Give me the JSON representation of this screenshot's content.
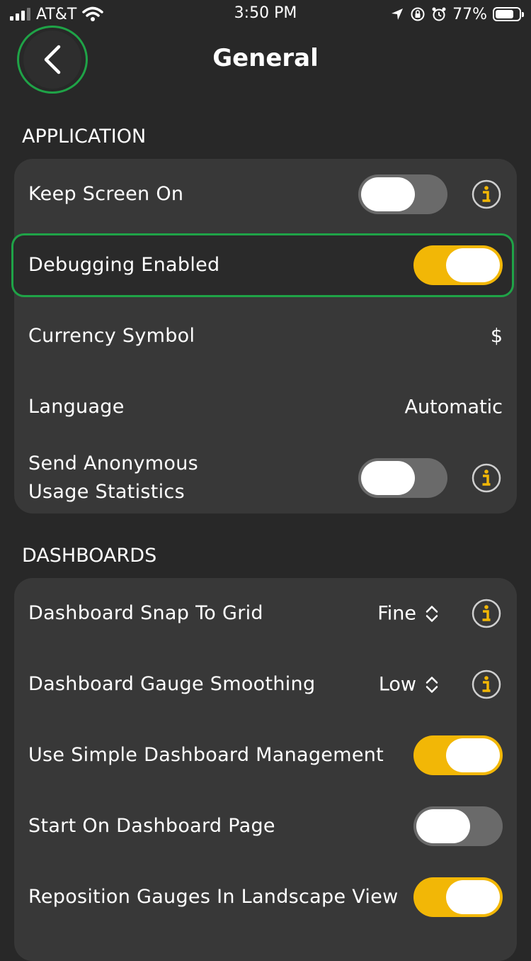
{
  "status_bar": {
    "carrier": "AT&T",
    "time": "3:50 PM",
    "battery": "77%",
    "battery_level": 0.77
  },
  "header": {
    "title": "General"
  },
  "sections": {
    "application": {
      "label": "APPLICATION",
      "rows": {
        "keep_screen_on": {
          "label": "Keep Screen On",
          "enabled": false
        },
        "debugging_enabled": {
          "label": "Debugging Enabled",
          "enabled": true
        },
        "currency_symbol": {
          "label": "Currency Symbol",
          "value": "$"
        },
        "language": {
          "label": "Language",
          "value": "Automatic"
        },
        "send_stats": {
          "label_line1": "Send Anonymous",
          "label_line2": "Usage Statistics",
          "enabled": false
        }
      }
    },
    "dashboards": {
      "label": "DASHBOARDS",
      "rows": {
        "snap_to_grid": {
          "label": "Dashboard Snap To Grid",
          "value": "Fine"
        },
        "gauge_smoothing": {
          "label": "Dashboard Gauge Smoothing",
          "value": "Low"
        },
        "simple_management": {
          "label": "Use Simple Dashboard Management",
          "enabled": true
        },
        "start_on_dashboard": {
          "label": "Start On Dashboard Page",
          "enabled": false
        },
        "reposition_gauges": {
          "label": "Reposition Gauges In Landscape View",
          "enabled": true
        }
      }
    }
  },
  "colors": {
    "accent": "#f2b706",
    "highlight": "#1fa347",
    "background": "#282828",
    "group_background": "#383838",
    "toggle_off": "#6a6a6a"
  },
  "icons": {
    "info": "info-icon",
    "back": "chevron-left-icon",
    "picker": "chevron-up-down-icon"
  }
}
